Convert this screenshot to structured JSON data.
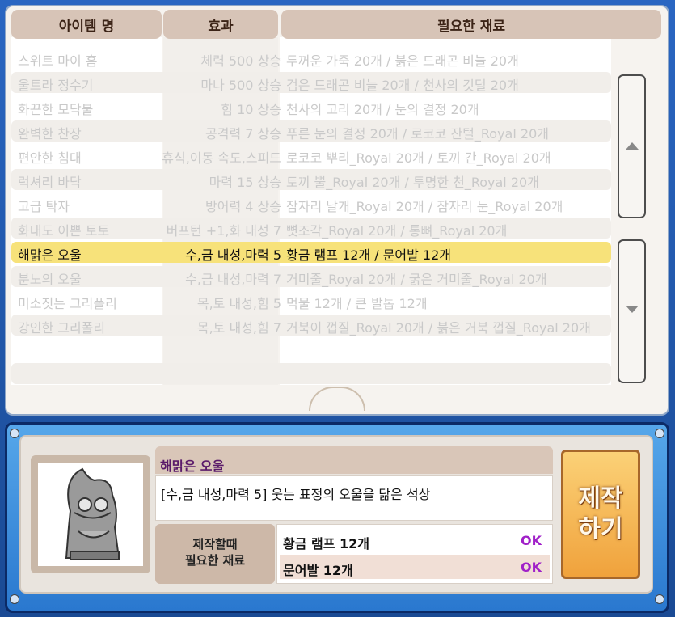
{
  "columns": [
    "아이템 명",
    "효과",
    "필요한 재료"
  ],
  "items": [
    {
      "name": "스위트 마이 홈",
      "effect": "체력 500 상승",
      "materials": "두꺼운 가죽 20개 / 붉은 드래곤 비늘 20개"
    },
    {
      "name": "울트라 정수기",
      "effect": "마나 500 상승",
      "materials": "검은 드래곤 비늘 20개 / 천사의 깃털 20개"
    },
    {
      "name": "화끈한 모닥불",
      "effect": "힘 10 상승",
      "materials": "천사의 고리 20개 / 눈의 결정 20개"
    },
    {
      "name": "완벽한 찬장",
      "effect": "공격력 7 상승",
      "materials": "푸른 눈의 결정 20개 / 로코코 잔털_Royal 20개"
    },
    {
      "name": "편안한 침대",
      "effect": "휴식,이동 속도,스피드",
      "materials": "로코코 뿌리_Royal 20개 / 토끼 간_Royal 20개"
    },
    {
      "name": "럭셔리 바닥",
      "effect": "마력 15 상승",
      "materials": "토끼 뿔_Royal 20개 / 투명한 천_Royal 20개"
    },
    {
      "name": "고급 탁자",
      "effect": "방어력 4 상승",
      "materials": "잠자리 날개_Royal 20개 / 잠자리 눈_Royal 20개"
    },
    {
      "name": "화내도 이쁜 토토",
      "effect": "버프턴 +1,화 내성 7",
      "materials": "뼛조각_Royal 20개 / 통뼈_Royal 20개"
    },
    {
      "name": "해맑은 오울",
      "effect": "수,금 내성,마력 5",
      "materials": "황금 램프 12개 / 문어발 12개"
    },
    {
      "name": "분노의 오울",
      "effect": "수,금 내성,마력 7",
      "materials": "거미줄_Royal 20개 / 굵은 거미줄_Royal 20개"
    },
    {
      "name": "미소짓는 그리폴리",
      "effect": "목,토 내성,힘 5",
      "materials": "먹물 12개 / 큰 발톱 12개"
    },
    {
      "name": "강인한 그리폴리",
      "effect": "목,토 내성,힘 7",
      "materials": "거북이 껍질_Royal 20개 / 붉은 거북 껍질_Royal 20개"
    }
  ],
  "selected": {
    "name": "해맑은 오울",
    "description": "[수,금 내성,마력 5] 웃는 표정의 오울을 닮은 석상",
    "required_label": "제작할때\n필요한 재료",
    "requirements": [
      {
        "name": "황금 램프 12개",
        "status": "OK"
      },
      {
        "name": "문어발 12개",
        "status": "OK"
      }
    ]
  },
  "craft_button": "제작\n하기",
  "colors": {
    "selected_row": "#f7e27a",
    "ok": "#a020c8",
    "craft_button": "#f0a23c"
  }
}
